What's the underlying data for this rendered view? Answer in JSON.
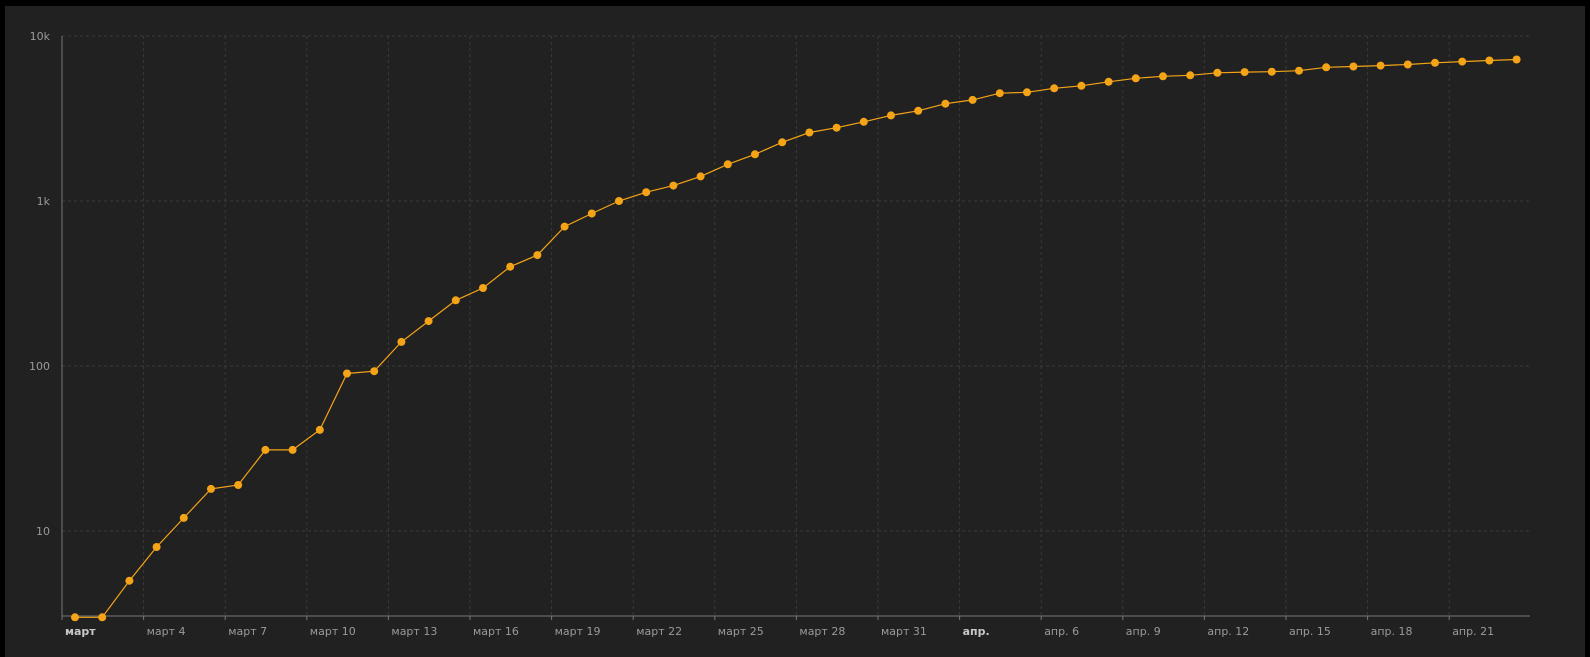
{
  "chart_data": {
    "type": "line",
    "title": "",
    "xlabel": "",
    "ylabel": "",
    "yscale": "log",
    "ylim": [
      3,
      10000
    ],
    "grid": true,
    "legend": "none",
    "color": "#f5a417",
    "x_start": "2020-03-01",
    "x_end": "2020-04-23",
    "y_ticks": [
      {
        "value": 10,
        "label": "10"
      },
      {
        "value": 100,
        "label": "100"
      },
      {
        "value": 1000,
        "label": "1k"
      },
      {
        "value": 10000,
        "label": "10k"
      }
    ],
    "x_ticks": [
      {
        "date": "2020-03-01",
        "label": "март",
        "major": true
      },
      {
        "date": "2020-03-04",
        "label": "март 4"
      },
      {
        "date": "2020-03-07",
        "label": "март 7"
      },
      {
        "date": "2020-03-10",
        "label": "март 10"
      },
      {
        "date": "2020-03-13",
        "label": "март 13"
      },
      {
        "date": "2020-03-16",
        "label": "март 16"
      },
      {
        "date": "2020-03-19",
        "label": "март 19"
      },
      {
        "date": "2020-03-22",
        "label": "март 22"
      },
      {
        "date": "2020-03-25",
        "label": "март 25"
      },
      {
        "date": "2020-03-28",
        "label": "март 28"
      },
      {
        "date": "2020-03-31",
        "label": "март 31"
      },
      {
        "date": "2020-04-03",
        "label": "апр.",
        "major": true
      },
      {
        "date": "2020-04-06",
        "label": "апр. 6"
      },
      {
        "date": "2020-04-09",
        "label": "апр. 9"
      },
      {
        "date": "2020-04-12",
        "label": "апр. 12"
      },
      {
        "date": "2020-04-15",
        "label": "апр. 15"
      },
      {
        "date": "2020-04-18",
        "label": "апр. 18"
      },
      {
        "date": "2020-04-21",
        "label": "апр. 21"
      }
    ],
    "series": [
      {
        "x": [
          "2020-03-01",
          "2020-03-02",
          "2020-03-03",
          "2020-03-04",
          "2020-03-05",
          "2020-03-06",
          "2020-03-07",
          "2020-03-08",
          "2020-03-09",
          "2020-03-10",
          "2020-03-11",
          "2020-03-12",
          "2020-03-13",
          "2020-03-14",
          "2020-03-15",
          "2020-03-16",
          "2020-03-17",
          "2020-03-18",
          "2020-03-19",
          "2020-03-20",
          "2020-03-21",
          "2020-03-22",
          "2020-03-23",
          "2020-03-24",
          "2020-03-25",
          "2020-03-26",
          "2020-03-27",
          "2020-03-28",
          "2020-03-29",
          "2020-03-30",
          "2020-03-31",
          "2020-04-01",
          "2020-04-02",
          "2020-04-03",
          "2020-04-04",
          "2020-04-05",
          "2020-04-06",
          "2020-04-07",
          "2020-04-08",
          "2020-04-09",
          "2020-04-10",
          "2020-04-11",
          "2020-04-12",
          "2020-04-13",
          "2020-04-14",
          "2020-04-15",
          "2020-04-16",
          "2020-04-17",
          "2020-04-18",
          "2020-04-19",
          "2020-04-20",
          "2020-04-21",
          "2020-04-22",
          "2020-04-23"
        ],
        "values": [
          3,
          3,
          5,
          8,
          12,
          18,
          19,
          31,
          31,
          41,
          90,
          93,
          140,
          187,
          250,
          297,
          400,
          470,
          700,
          840,
          1000,
          1130,
          1240,
          1410,
          1670,
          1920,
          2270,
          2600,
          2780,
          3020,
          3300,
          3520,
          3890,
          4100,
          4500,
          4560,
          4820,
          4990,
          5280,
          5540,
          5700,
          5780,
          5980,
          6040,
          6080,
          6160,
          6460,
          6530,
          6620,
          6720,
          6880,
          7000,
          7100,
          7200
        ]
      }
    ]
  }
}
